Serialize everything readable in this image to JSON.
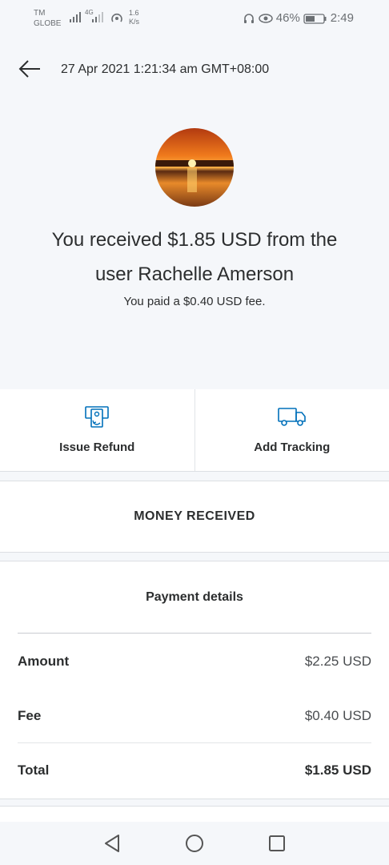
{
  "status_bar": {
    "carrier_line1": "TM",
    "carrier_line2": "GLOBE",
    "network": "4G",
    "speed_value": "1.6",
    "speed_unit": "K/s",
    "battery": "46%",
    "time": "2:49"
  },
  "header": {
    "datetime": "27 Apr 2021 1:21:34 am GMT+08:00"
  },
  "summary": {
    "headline_line1": "You received $1.85 USD from the",
    "headline_line2": "user Rachelle Amerson",
    "fee_note": "You paid a $0.40 USD fee."
  },
  "actions": [
    {
      "label": "Issue Refund",
      "icon": "refund-icon"
    },
    {
      "label": "Add Tracking",
      "icon": "truck-icon"
    }
  ],
  "status_section": {
    "title": "MONEY RECEIVED"
  },
  "payment_details": {
    "title": "Payment details",
    "rows": [
      {
        "label": "Amount",
        "value": "$2.25 USD"
      },
      {
        "label": "Fee",
        "value": "$0.40 USD"
      },
      {
        "label": "Total",
        "value": "$1.85 USD"
      }
    ]
  },
  "colors": {
    "accent": "#0070ba",
    "background": "#f5f7fa",
    "text": "#2c2e2f"
  }
}
